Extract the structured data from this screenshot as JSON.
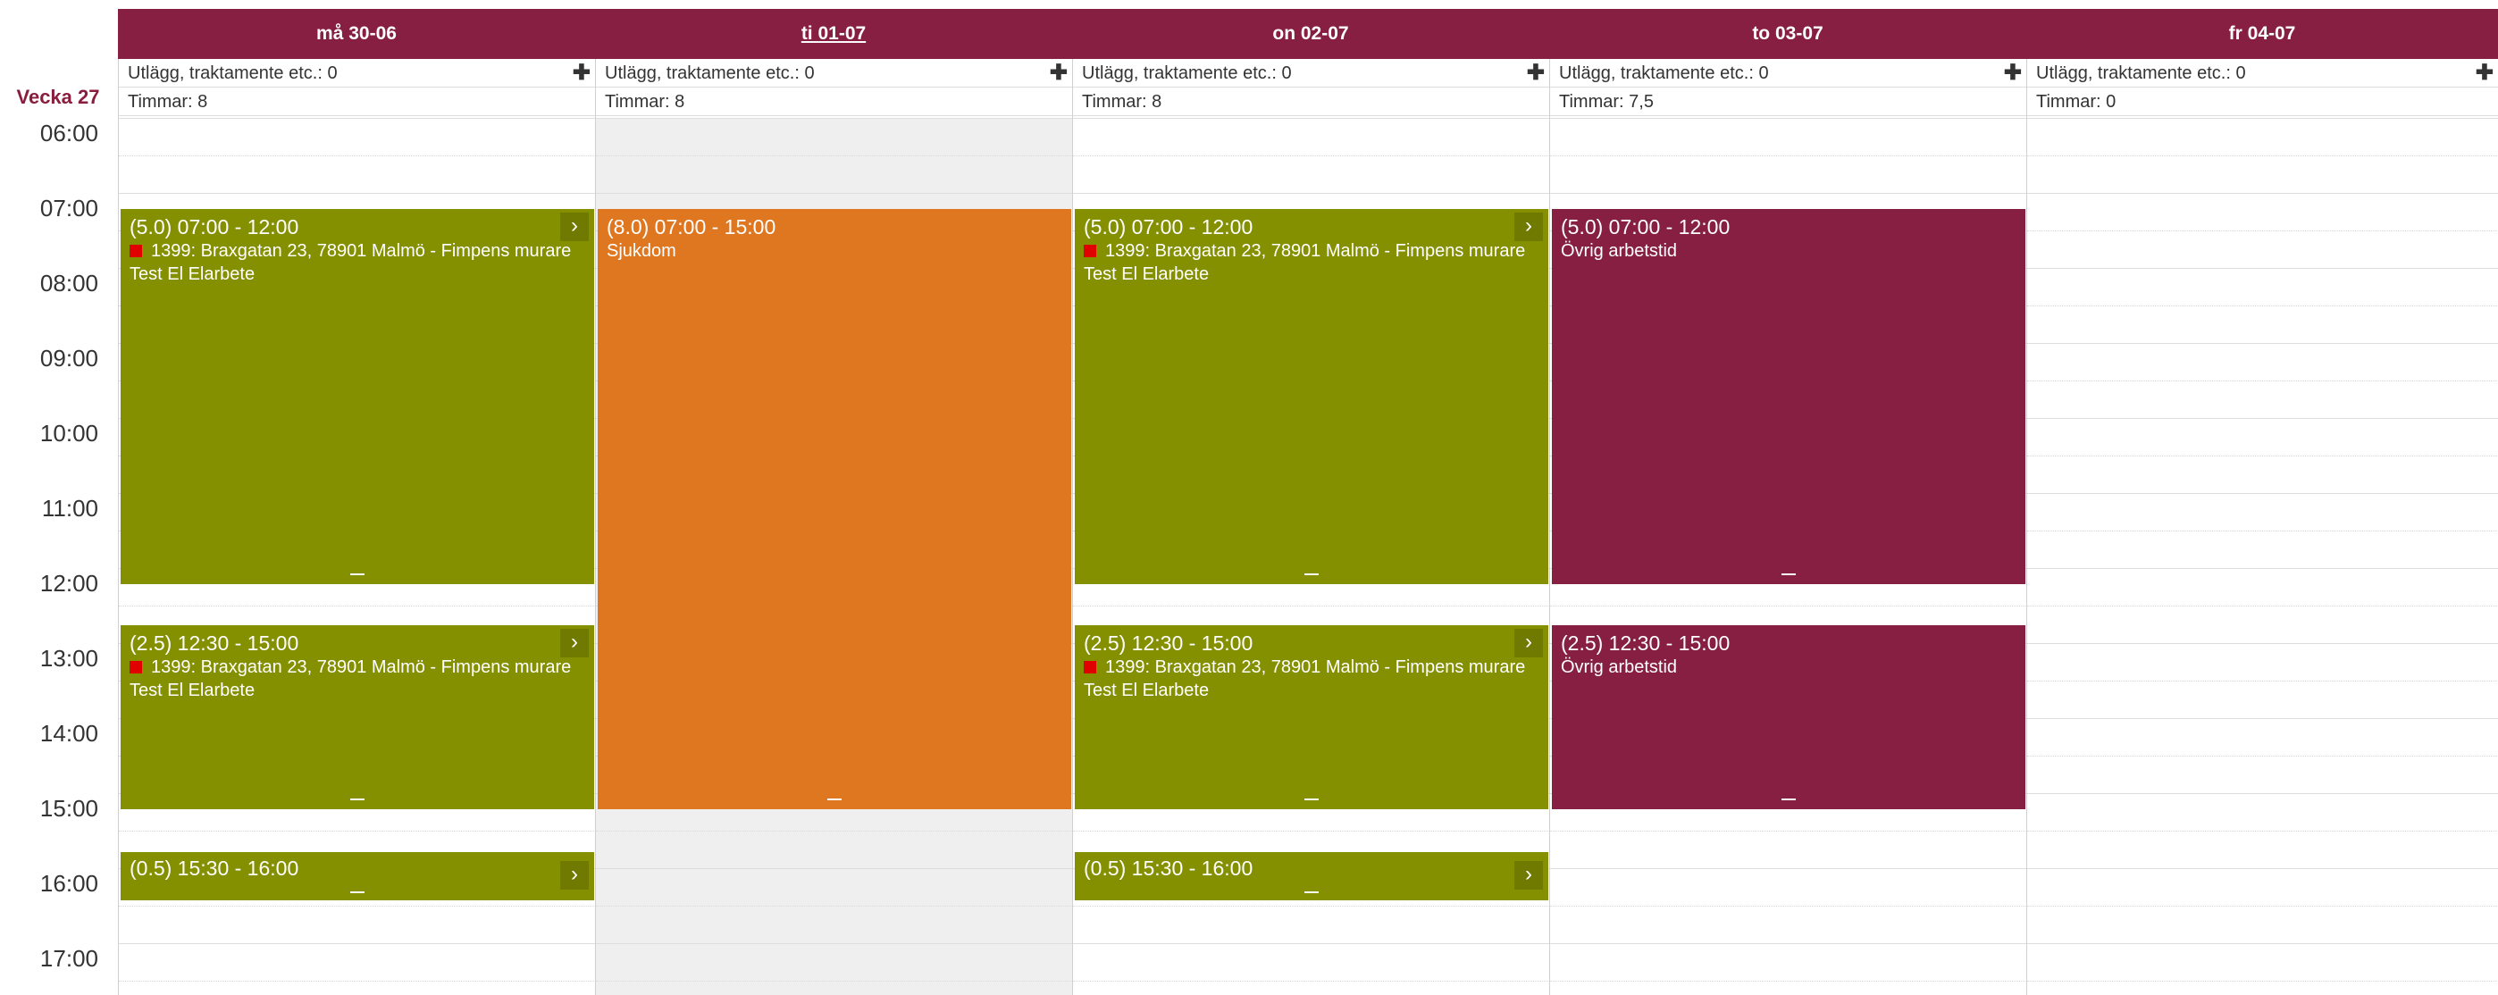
{
  "week_label": "Vecka 27",
  "times": [
    "06:00",
    "07:00",
    "08:00",
    "09:00",
    "10:00",
    "11:00",
    "12:00",
    "13:00",
    "14:00",
    "15:00",
    "16:00",
    "17:00"
  ],
  "days": [
    {
      "header": "må 30-06",
      "expenses": "Utlägg, traktamente etc.: 0",
      "hours": "Timmar: 8",
      "events": [
        {
          "duration_time": "(5.0) 07:00 - 12:00",
          "project": "1399: Braxgatan 23, 78901 Malmö - Fimpens murare",
          "activity": "Test El Elarbete"
        },
        {
          "duration_time": "(2.5) 12:30 - 15:00",
          "project": "1399: Braxgatan 23, 78901 Malmö - Fimpens murare",
          "activity": "Test El Elarbete"
        },
        {
          "duration_time": "(0.5) 15:30 - 16:00"
        }
      ]
    },
    {
      "header": "ti 01-07",
      "expenses": "Utlägg, traktamente etc.: 0",
      "hours": "Timmar: 8",
      "events": [
        {
          "duration_time": "(8.0) 07:00 - 15:00",
          "activity": "Sjukdom"
        }
      ]
    },
    {
      "header": "on 02-07",
      "expenses": "Utlägg, traktamente etc.: 0",
      "hours": "Timmar: 8",
      "events": [
        {
          "duration_time": "(5.0) 07:00 - 12:00",
          "project": "1399: Braxgatan 23, 78901 Malmö - Fimpens murare",
          "activity": "Test El Elarbete"
        },
        {
          "duration_time": "(2.5) 12:30 - 15:00",
          "project": "1399: Braxgatan 23, 78901 Malmö - Fimpens murare",
          "activity": "Test El Elarbete"
        },
        {
          "duration_time": "(0.5) 15:30 - 16:00"
        }
      ]
    },
    {
      "header": "to 03-07",
      "expenses": "Utlägg, traktamente etc.: 0",
      "hours": "Timmar: 7,5",
      "events": [
        {
          "duration_time": "(5.0) 07:00 - 12:00",
          "activity": "Övrig arbetstid"
        },
        {
          "duration_time": "(2.5) 12:30 - 15:00",
          "activity": "Övrig arbetstid"
        }
      ]
    },
    {
      "header": "fr 04-07",
      "expenses": "Utlägg, traktamente etc.: 0",
      "hours": "Timmar: 0",
      "events": []
    }
  ],
  "colors": {
    "header": "#861f41",
    "work": "#849000",
    "sick": "#df7620",
    "other": "#861f41",
    "project_marker": "#e00000"
  },
  "icons": {
    "add": "plus-icon",
    "open": "chevron-right-icon",
    "resize": "resize-handle-icon"
  }
}
